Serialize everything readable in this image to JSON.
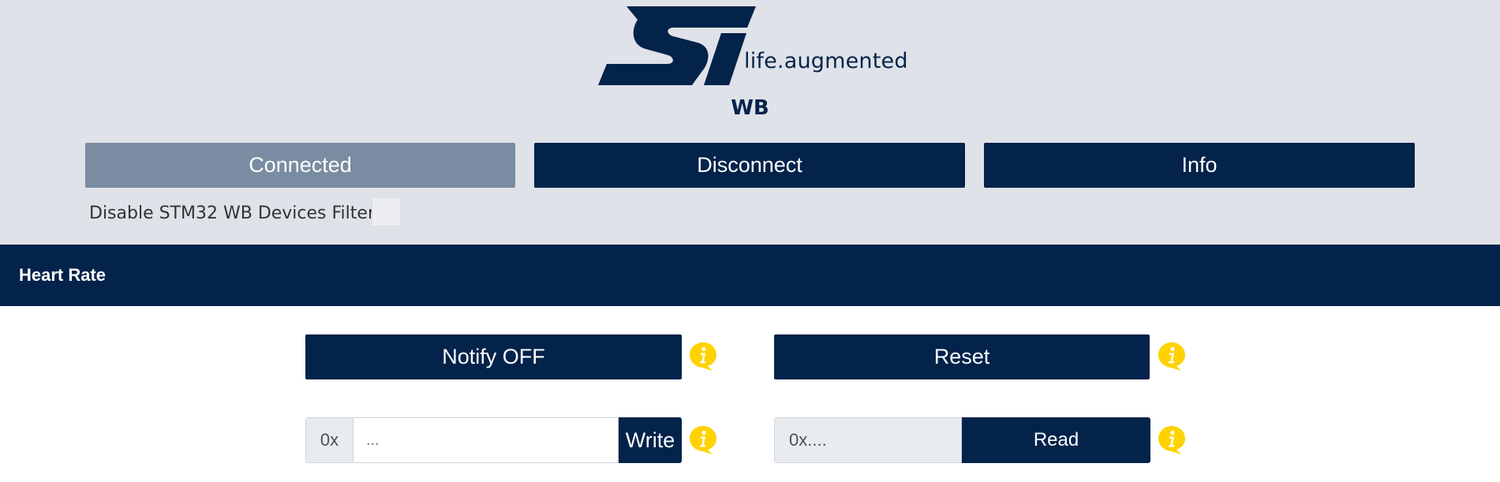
{
  "header": {
    "tagline": "life.augmented",
    "device_name": "WB",
    "buttons": {
      "connected": "Connected",
      "disconnect": "Disconnect",
      "info": "Info"
    },
    "filter_label": "Disable STM32 WB Devices Filter",
    "filter_checked": false
  },
  "service": {
    "title": "Heart Rate",
    "notify_label": "Notify OFF",
    "reset_label": "Reset",
    "write": {
      "prefix": "0x",
      "placeholder": "...",
      "button_label": "Write"
    },
    "read": {
      "value": "0x....",
      "button_label": "Read"
    },
    "info_icon": "info-speech-bubble-icon"
  },
  "colors": {
    "navy": "#03234b",
    "disabled_grey": "#7a8ca1",
    "header_bg": "#dfe2e8",
    "info_yellow": "#ffd200"
  }
}
